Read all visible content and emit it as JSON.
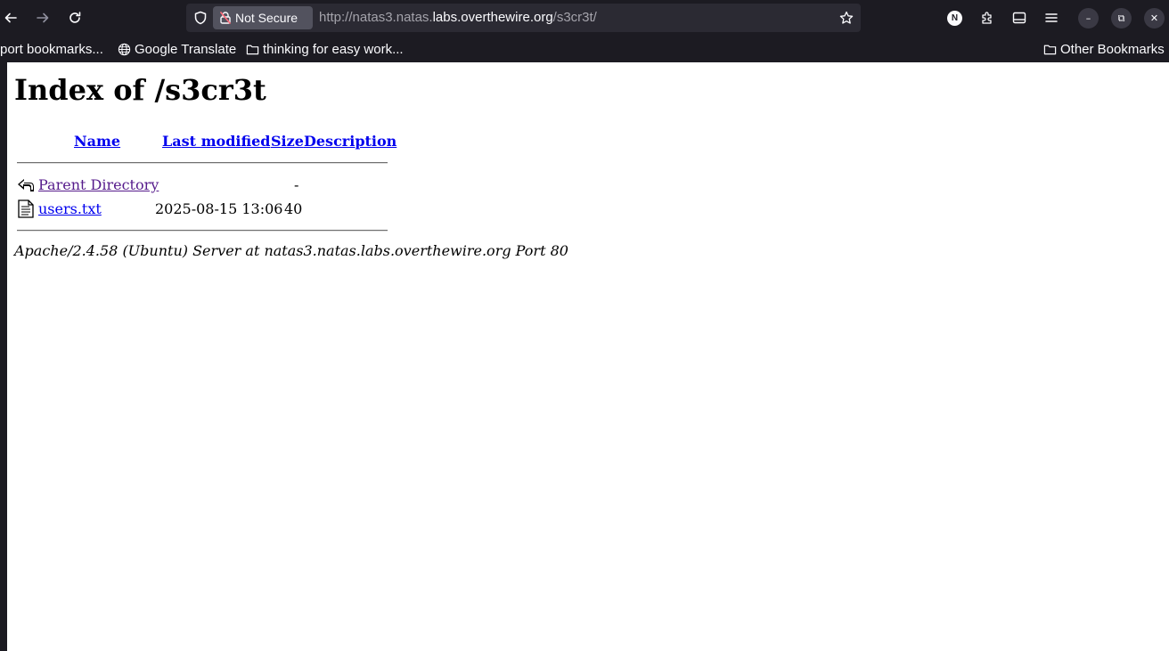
{
  "browser": {
    "security_label": "Not Secure",
    "url_prefix": "http://natas3.natas.",
    "url_domain": "labs.overthewire.org",
    "url_path": "/s3cr3t/",
    "account_initial": "N",
    "accent_color": "#fbfbfe"
  },
  "bookmarks": {
    "items": [
      {
        "label": "port bookmarks...",
        "icon": "none"
      },
      {
        "label": "Google Translate",
        "icon": "globe-icon"
      },
      {
        "label": "thinking for easy work...",
        "icon": "folder-icon"
      }
    ],
    "other_label": "Other Bookmarks"
  },
  "page": {
    "title": "Index of /s3cr3t",
    "headers": {
      "name": "Name",
      "last_modified": "Last modified",
      "size": "Size",
      "description": "Description"
    },
    "rows": [
      {
        "name": "Parent Directory",
        "modified": "",
        "size": "-",
        "description": "",
        "icon": "back-arrow-icon",
        "visited": true
      },
      {
        "name": "users.txt",
        "modified": "2025-08-15 13:06",
        "size": "40",
        "description": "",
        "icon": "text-file-icon",
        "visited": false
      }
    ],
    "address": "Apache/2.4.58 (Ubuntu) Server at natas3.natas.labs.overthewire.org Port 80"
  }
}
